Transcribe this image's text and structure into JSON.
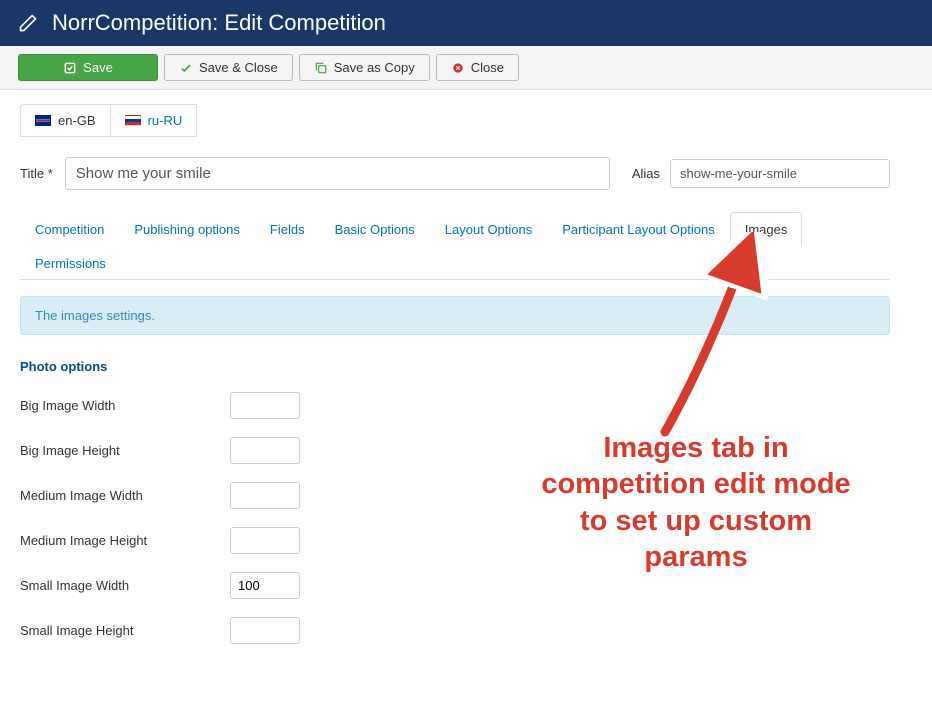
{
  "header": {
    "title": "NorrCompetition: Edit Competition"
  },
  "toolbar": {
    "save": "Save",
    "save_close": "Save & Close",
    "save_copy": "Save as Copy",
    "close": "Close"
  },
  "lang": {
    "active": "en-GB",
    "other": "ru-RU"
  },
  "form": {
    "title_label": "Title",
    "title_required": "*",
    "title_value": "Show me your smile",
    "alias_label": "Alias",
    "alias_value": "show-me-your-smile"
  },
  "tabs": {
    "competition": "Competition",
    "publishing": "Publishing options",
    "fields": "Fields",
    "basic": "Basic Options",
    "layout": "Layout Options",
    "participant_layout": "Participant Layout Options",
    "images": "Images",
    "permissions": "Permissions"
  },
  "info": "The images settings.",
  "section_title": "Photo options",
  "options": {
    "big_w_label": "Big Image Width",
    "big_w": "",
    "big_h_label": "Big Image Height",
    "big_h": "",
    "med_w_label": "Medium Image Width",
    "med_w": "",
    "med_h_label": "Medium Image Height",
    "med_h": "",
    "small_w_label": "Small Image Width",
    "small_w": "100",
    "small_h_label": "Small Image Height",
    "small_h": ""
  },
  "annotation": "Images tab in competition edit mode to set up custom params"
}
